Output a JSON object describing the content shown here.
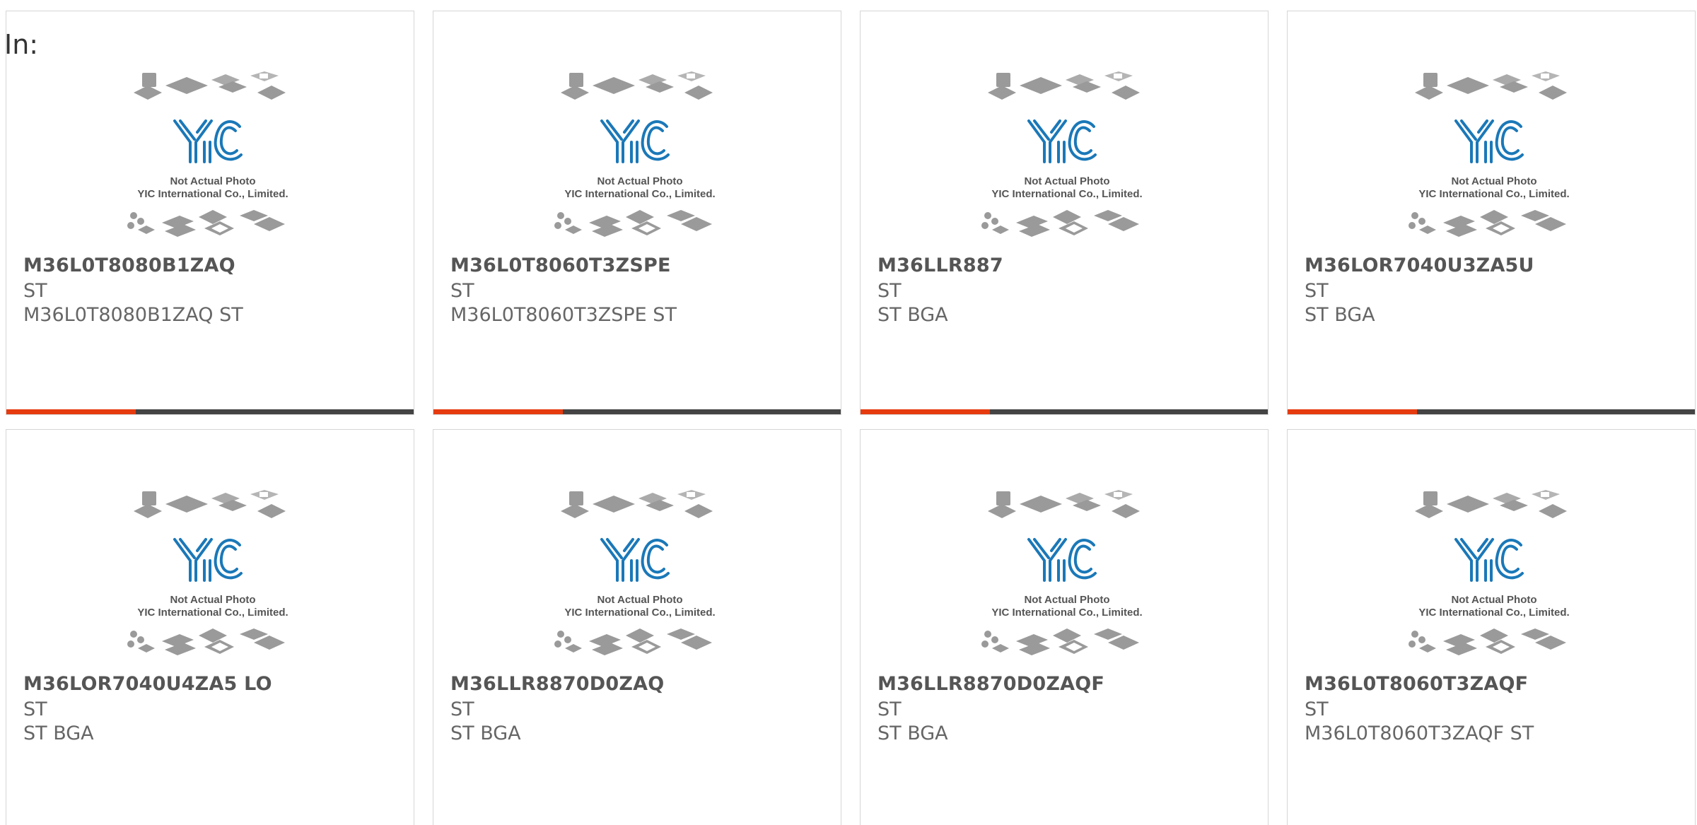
{
  "header": {
    "label": "In:"
  },
  "photo": {
    "caption_line1": "Not Actual Photo",
    "caption_line2": "YIC International Co., Limited.",
    "logo_text": "YIC"
  },
  "colors": {
    "accent": "#e63b0f",
    "bar": "#444444",
    "logo": "#1a78b8"
  },
  "products": [
    {
      "part": "M36L0T8080B1ZAQ",
      "maker": "ST",
      "desc": "M36L0T8080B1ZAQ ST"
    },
    {
      "part": "M36L0T8060T3ZSPE",
      "maker": "ST",
      "desc": "M36L0T8060T3ZSPE ST"
    },
    {
      "part": "M36LLR887",
      "maker": "ST",
      "desc": "ST BGA"
    },
    {
      "part": "M36LOR7040U3ZA5U",
      "maker": "ST",
      "desc": "ST BGA"
    },
    {
      "part": "M36LOR7040U4ZA5 LO",
      "maker": "ST",
      "desc": "ST BGA"
    },
    {
      "part": "M36LLR8870D0ZAQ",
      "maker": "ST",
      "desc": "ST BGA"
    },
    {
      "part": "M36LLR8870D0ZAQF",
      "maker": "ST",
      "desc": "ST BGA"
    },
    {
      "part": "M36L0T8060T3ZAQF",
      "maker": "ST",
      "desc": "M36L0T8060T3ZAQF ST"
    }
  ]
}
